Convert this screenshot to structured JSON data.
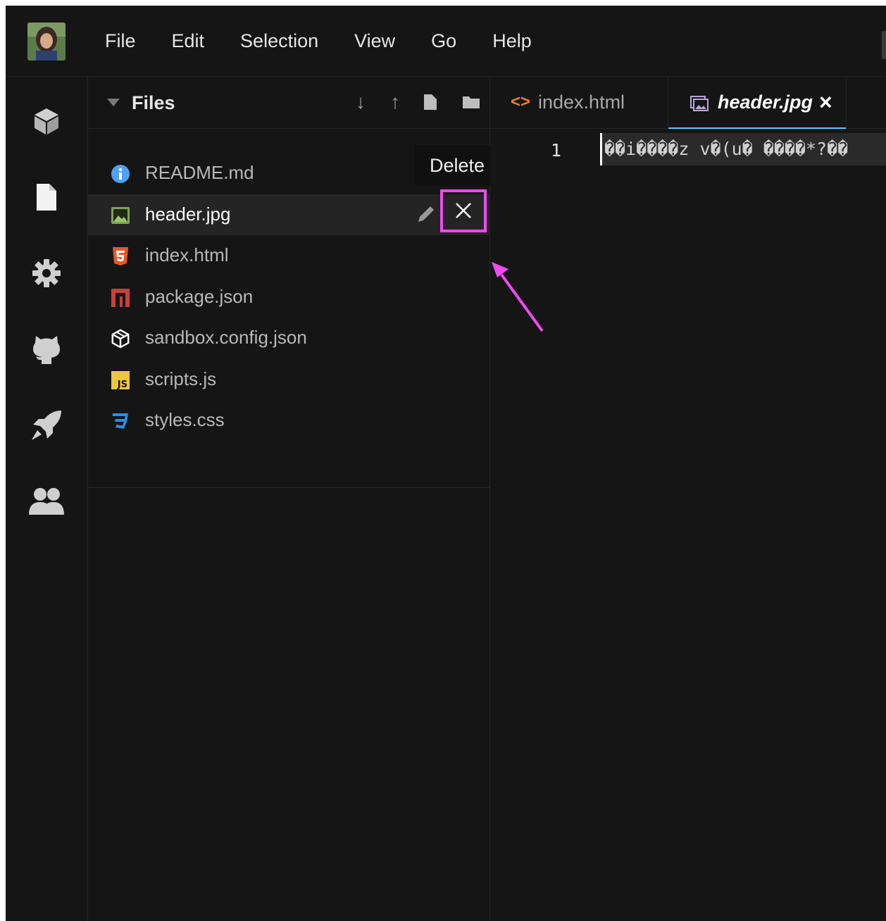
{
  "menu": {
    "items": [
      "File",
      "Edit",
      "Selection",
      "View",
      "Go",
      "Help"
    ]
  },
  "activity_bar": {
    "icons": [
      "cube-icon",
      "file-icon",
      "gear-icon",
      "github-icon",
      "rocket-icon",
      "users-icon"
    ]
  },
  "files_panel": {
    "title": "Files",
    "header_actions": [
      "download-icon",
      "upload-icon",
      "new-file-icon",
      "new-folder-icon"
    ],
    "items": [
      {
        "name": "README.md",
        "icon": "info-icon",
        "color": "#4ea1f5"
      },
      {
        "name": "header.jpg",
        "icon": "image-icon",
        "color": "#7fa45a",
        "active": true
      },
      {
        "name": "index.html",
        "icon": "html5-icon",
        "color": "#e8562a"
      },
      {
        "name": "package.json",
        "icon": "npm-icon",
        "color": "#c9413a"
      },
      {
        "name": "sandbox.config.json",
        "icon": "codesandbox-icon",
        "color": "#ffffff"
      },
      {
        "name": "scripts.js",
        "icon": "javascript-icon",
        "color": "#f0c640"
      },
      {
        "name": "styles.css",
        "icon": "css3-icon",
        "color": "#2f8de0"
      }
    ],
    "tooltip": "Delete"
  },
  "editor": {
    "tabs": [
      {
        "label": "index.html",
        "icon": "code-icon",
        "icon_text": "<>"
      },
      {
        "label": "header.jpg",
        "icon": "image-icon",
        "close_glyph": "×",
        "active": true
      }
    ],
    "line_number": "1",
    "line_content": "��i����z v�(u� ����*?��"
  },
  "colors": {
    "highlight": "#ef4bf2",
    "tab_underline": "#6cc7f6",
    "background": "#151515"
  }
}
